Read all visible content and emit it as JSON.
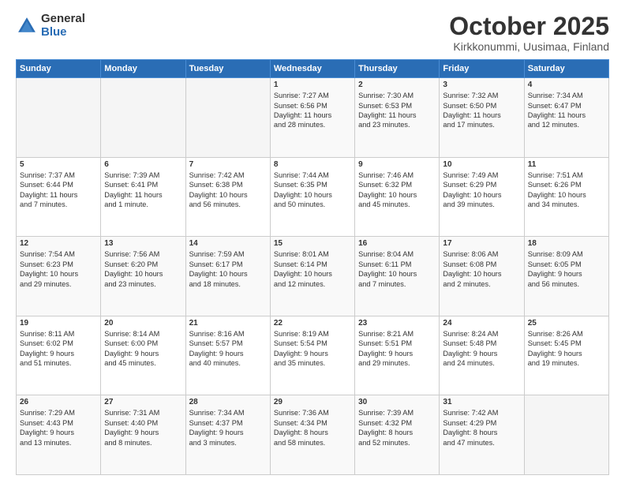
{
  "logo": {
    "general": "General",
    "blue": "Blue"
  },
  "header": {
    "month": "October 2025",
    "location": "Kirkkonummi, Uusimaa, Finland"
  },
  "weekdays": [
    "Sunday",
    "Monday",
    "Tuesday",
    "Wednesday",
    "Thursday",
    "Friday",
    "Saturday"
  ],
  "weeks": [
    [
      {
        "day": "",
        "content": ""
      },
      {
        "day": "",
        "content": ""
      },
      {
        "day": "",
        "content": ""
      },
      {
        "day": "1",
        "content": "Sunrise: 7:27 AM\nSunset: 6:56 PM\nDaylight: 11 hours\nand 28 minutes."
      },
      {
        "day": "2",
        "content": "Sunrise: 7:30 AM\nSunset: 6:53 PM\nDaylight: 11 hours\nand 23 minutes."
      },
      {
        "day": "3",
        "content": "Sunrise: 7:32 AM\nSunset: 6:50 PM\nDaylight: 11 hours\nand 17 minutes."
      },
      {
        "day": "4",
        "content": "Sunrise: 7:34 AM\nSunset: 6:47 PM\nDaylight: 11 hours\nand 12 minutes."
      }
    ],
    [
      {
        "day": "5",
        "content": "Sunrise: 7:37 AM\nSunset: 6:44 PM\nDaylight: 11 hours\nand 7 minutes."
      },
      {
        "day": "6",
        "content": "Sunrise: 7:39 AM\nSunset: 6:41 PM\nDaylight: 11 hours\nand 1 minute."
      },
      {
        "day": "7",
        "content": "Sunrise: 7:42 AM\nSunset: 6:38 PM\nDaylight: 10 hours\nand 56 minutes."
      },
      {
        "day": "8",
        "content": "Sunrise: 7:44 AM\nSunset: 6:35 PM\nDaylight: 10 hours\nand 50 minutes."
      },
      {
        "day": "9",
        "content": "Sunrise: 7:46 AM\nSunset: 6:32 PM\nDaylight: 10 hours\nand 45 minutes."
      },
      {
        "day": "10",
        "content": "Sunrise: 7:49 AM\nSunset: 6:29 PM\nDaylight: 10 hours\nand 39 minutes."
      },
      {
        "day": "11",
        "content": "Sunrise: 7:51 AM\nSunset: 6:26 PM\nDaylight: 10 hours\nand 34 minutes."
      }
    ],
    [
      {
        "day": "12",
        "content": "Sunrise: 7:54 AM\nSunset: 6:23 PM\nDaylight: 10 hours\nand 29 minutes."
      },
      {
        "day": "13",
        "content": "Sunrise: 7:56 AM\nSunset: 6:20 PM\nDaylight: 10 hours\nand 23 minutes."
      },
      {
        "day": "14",
        "content": "Sunrise: 7:59 AM\nSunset: 6:17 PM\nDaylight: 10 hours\nand 18 minutes."
      },
      {
        "day": "15",
        "content": "Sunrise: 8:01 AM\nSunset: 6:14 PM\nDaylight: 10 hours\nand 12 minutes."
      },
      {
        "day": "16",
        "content": "Sunrise: 8:04 AM\nSunset: 6:11 PM\nDaylight: 10 hours\nand 7 minutes."
      },
      {
        "day": "17",
        "content": "Sunrise: 8:06 AM\nSunset: 6:08 PM\nDaylight: 10 hours\nand 2 minutes."
      },
      {
        "day": "18",
        "content": "Sunrise: 8:09 AM\nSunset: 6:05 PM\nDaylight: 9 hours\nand 56 minutes."
      }
    ],
    [
      {
        "day": "19",
        "content": "Sunrise: 8:11 AM\nSunset: 6:02 PM\nDaylight: 9 hours\nand 51 minutes."
      },
      {
        "day": "20",
        "content": "Sunrise: 8:14 AM\nSunset: 6:00 PM\nDaylight: 9 hours\nand 45 minutes."
      },
      {
        "day": "21",
        "content": "Sunrise: 8:16 AM\nSunset: 5:57 PM\nDaylight: 9 hours\nand 40 minutes."
      },
      {
        "day": "22",
        "content": "Sunrise: 8:19 AM\nSunset: 5:54 PM\nDaylight: 9 hours\nand 35 minutes."
      },
      {
        "day": "23",
        "content": "Sunrise: 8:21 AM\nSunset: 5:51 PM\nDaylight: 9 hours\nand 29 minutes."
      },
      {
        "day": "24",
        "content": "Sunrise: 8:24 AM\nSunset: 5:48 PM\nDaylight: 9 hours\nand 24 minutes."
      },
      {
        "day": "25",
        "content": "Sunrise: 8:26 AM\nSunset: 5:45 PM\nDaylight: 9 hours\nand 19 minutes."
      }
    ],
    [
      {
        "day": "26",
        "content": "Sunrise: 7:29 AM\nSunset: 4:43 PM\nDaylight: 9 hours\nand 13 minutes."
      },
      {
        "day": "27",
        "content": "Sunrise: 7:31 AM\nSunset: 4:40 PM\nDaylight: 9 hours\nand 8 minutes."
      },
      {
        "day": "28",
        "content": "Sunrise: 7:34 AM\nSunset: 4:37 PM\nDaylight: 9 hours\nand 3 minutes."
      },
      {
        "day": "29",
        "content": "Sunrise: 7:36 AM\nSunset: 4:34 PM\nDaylight: 8 hours\nand 58 minutes."
      },
      {
        "day": "30",
        "content": "Sunrise: 7:39 AM\nSunset: 4:32 PM\nDaylight: 8 hours\nand 52 minutes."
      },
      {
        "day": "31",
        "content": "Sunrise: 7:42 AM\nSunset: 4:29 PM\nDaylight: 8 hours\nand 47 minutes."
      },
      {
        "day": "",
        "content": ""
      }
    ]
  ]
}
